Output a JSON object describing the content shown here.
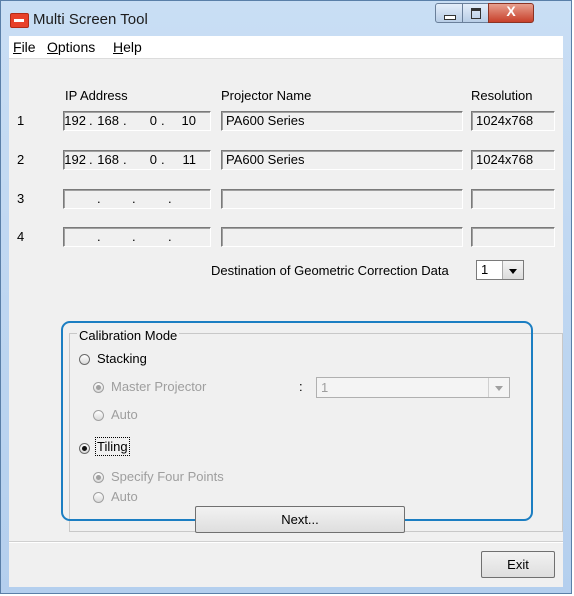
{
  "window": {
    "title": "Multi Screen Tool",
    "close_glyph": "X"
  },
  "menu": [
    {
      "key": "F",
      "rest": "ile"
    },
    {
      "key": "O",
      "rest": "ptions"
    },
    {
      "key": "H",
      "rest": "elp"
    }
  ],
  "table": {
    "headers": {
      "ip": "IP Address",
      "name": "Projector Name",
      "resolution": "Resolution"
    },
    "rows": [
      {
        "num": "1",
        "ip": [
          "192",
          "168",
          "0",
          "10"
        ],
        "name": "PA600 Series",
        "resolution": "1024x768"
      },
      {
        "num": "2",
        "ip": [
          "192",
          "168",
          "0",
          "11"
        ],
        "name": "PA600 Series",
        "resolution": "1024x768"
      },
      {
        "num": "3",
        "ip": [
          "",
          "",
          "",
          ""
        ],
        "name": "",
        "resolution": ""
      },
      {
        "num": "4",
        "ip": [
          "",
          "",
          "",
          ""
        ],
        "name": "",
        "resolution": ""
      }
    ],
    "ip_dot": "."
  },
  "destination": {
    "label": "Destination of Geometric Correction Data",
    "value": "1"
  },
  "calibration": {
    "group_label": "Calibration Mode",
    "stacking": {
      "label": "Stacking",
      "selected": false
    },
    "master_projector": {
      "label": "Master Projector",
      "colon": ":",
      "value": "1"
    },
    "stacking_auto": {
      "label": "Auto"
    },
    "tiling": {
      "label": "Tiling",
      "selected": true
    },
    "specify_four_points": {
      "label": "Specify Four Points"
    },
    "tiling_auto": {
      "label": "Auto"
    }
  },
  "buttons": {
    "next": "Next...",
    "exit": "Exit"
  },
  "colors": {
    "highlight": "#1b7ec2",
    "close_button": "#c7402a",
    "app_icon": "#e8412a"
  }
}
